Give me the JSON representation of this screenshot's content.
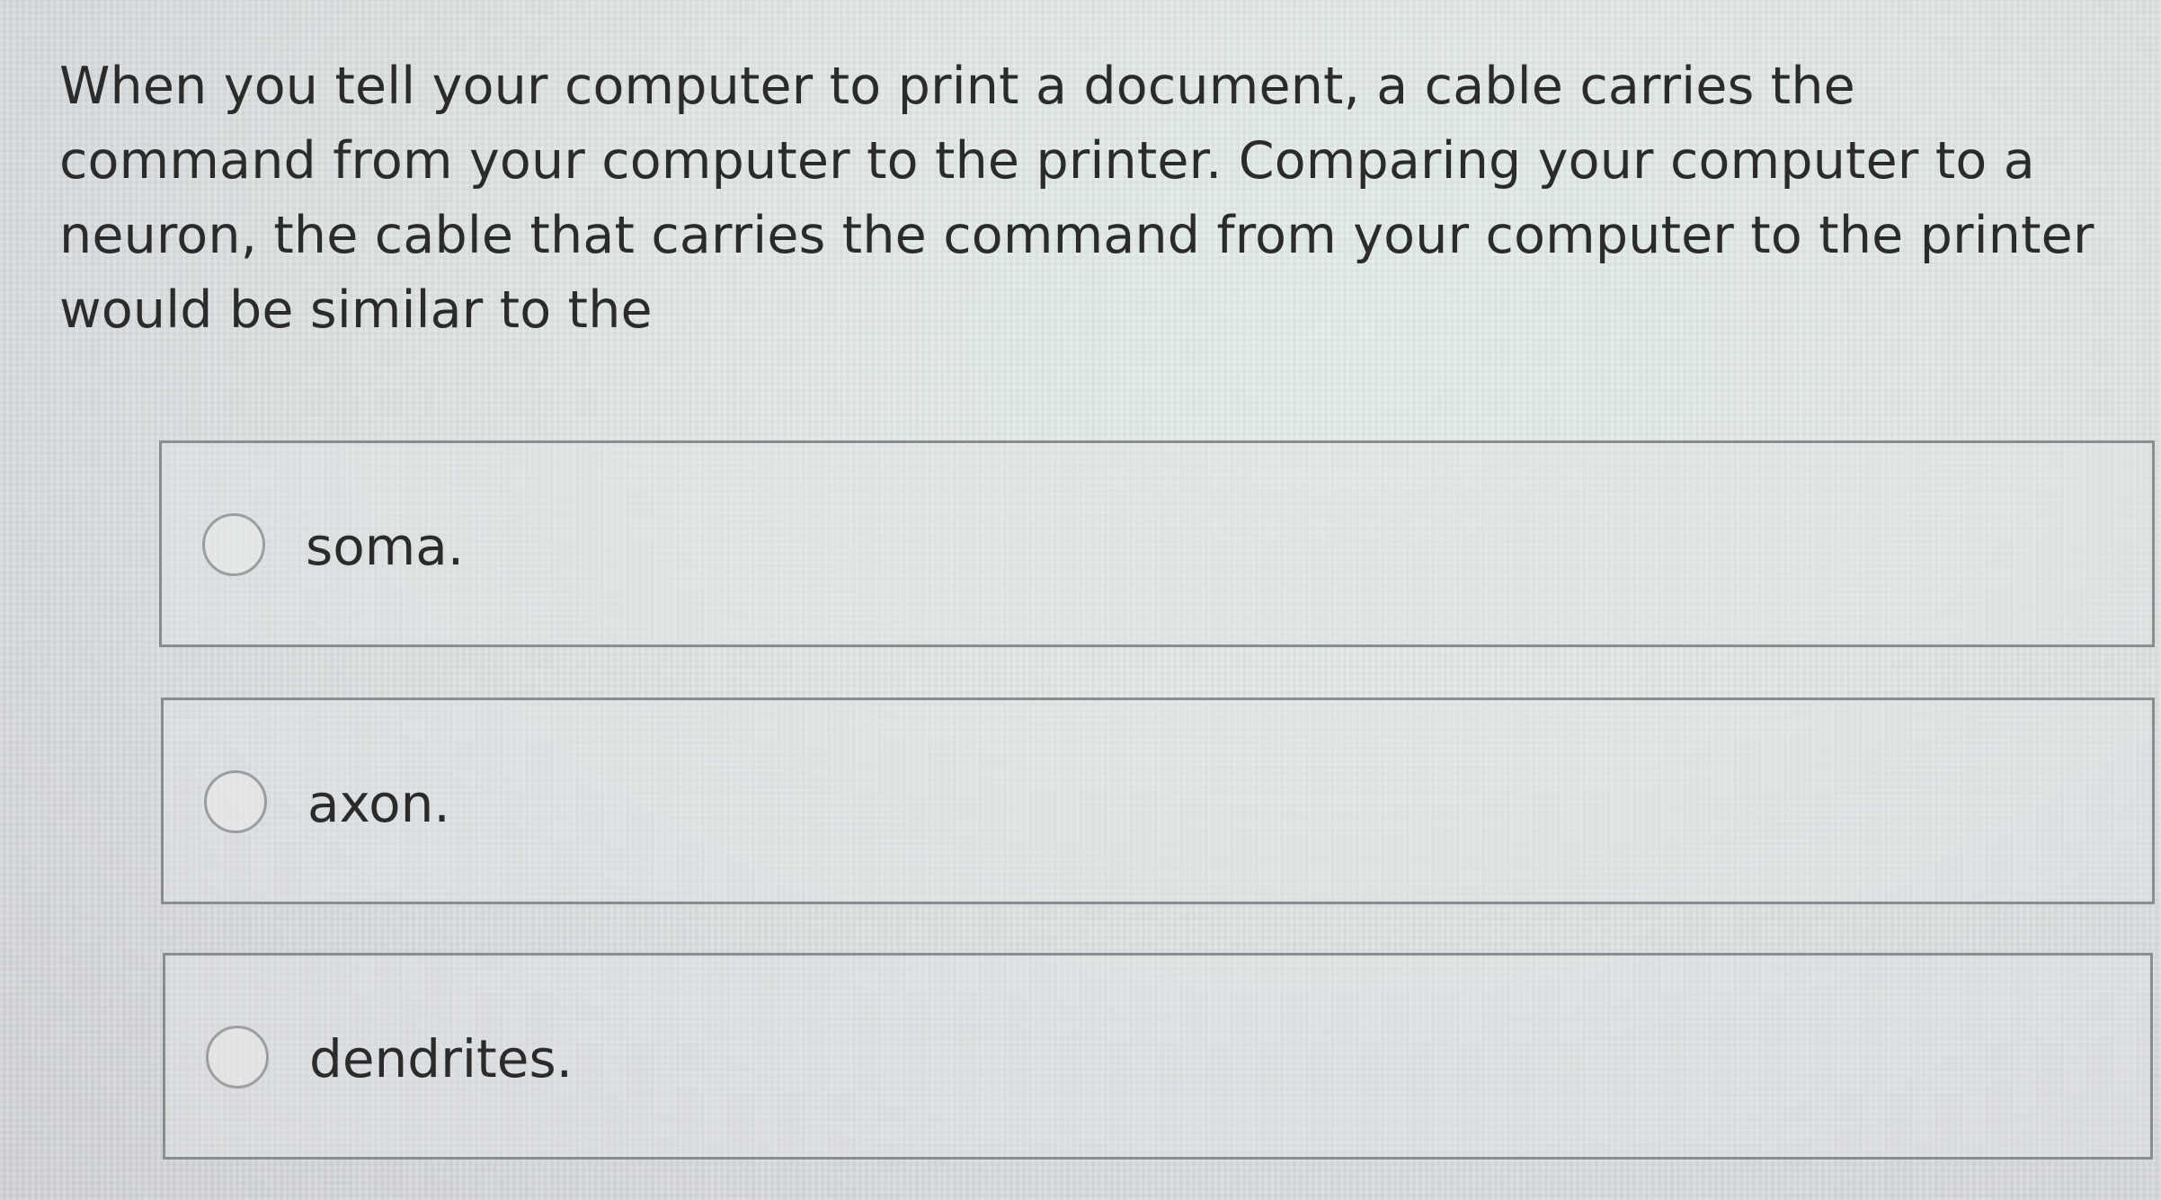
{
  "question": {
    "text": "When you tell your computer to print a document, a cable carries the command from your computer to the printer. Comparing your computer to a neuron, the cable that carries the command from your computer to the printer would be similar to the"
  },
  "options": [
    {
      "label": "soma.",
      "selected": false
    },
    {
      "label": "axon.",
      "selected": false
    },
    {
      "label": "dendrites.",
      "selected": false
    }
  ],
  "colors": {
    "text": "#2b2b2b",
    "border": "#8a8d8f",
    "radio_border": "#9b9d9f"
  }
}
